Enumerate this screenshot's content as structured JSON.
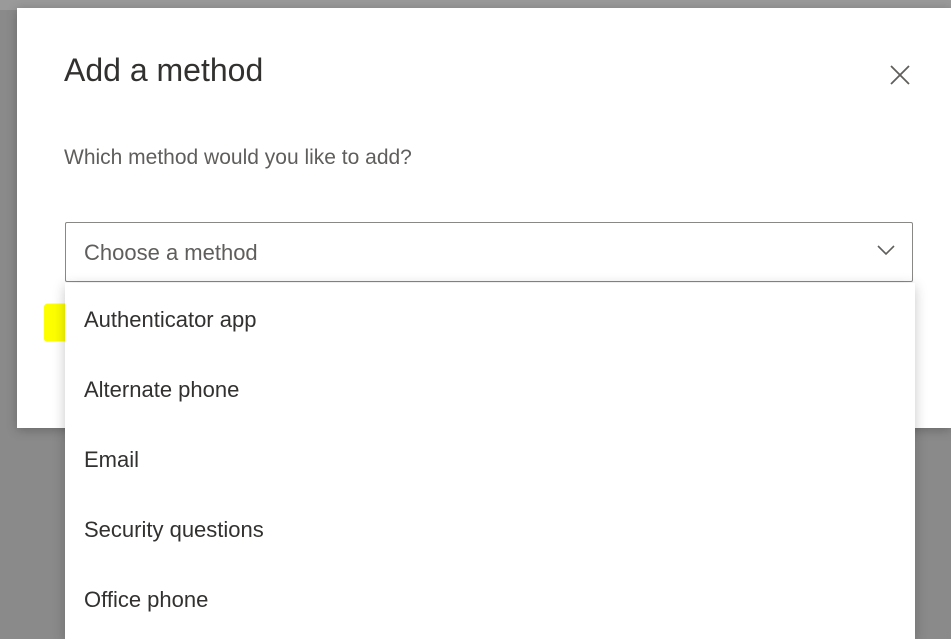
{
  "dialog": {
    "title": "Add a method",
    "subtitle": "Which method would you like to add?",
    "close_icon": "close-icon"
  },
  "method_select": {
    "placeholder": "Choose a method",
    "chevron_icon": "chevron-down-icon"
  },
  "dropdown": {
    "options": [
      {
        "label": "Authenticator app",
        "highlighted": true
      },
      {
        "label": "Alternate phone"
      },
      {
        "label": "Email"
      },
      {
        "label": "Security questions"
      },
      {
        "label": "Office phone"
      }
    ]
  },
  "colors": {
    "highlight": "#fdff00",
    "overlay": "#8a8a8a",
    "text_primary": "#323130",
    "text_secondary": "#605e5c",
    "border": "#8a8886"
  }
}
